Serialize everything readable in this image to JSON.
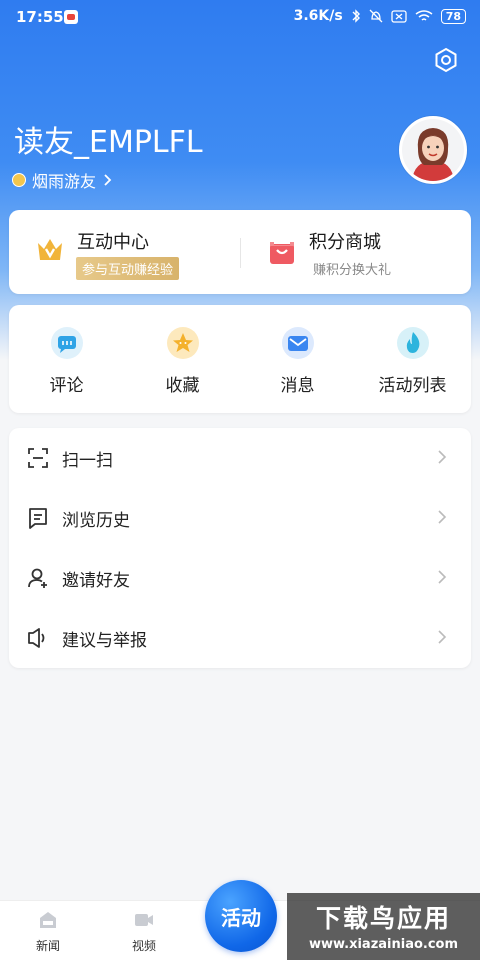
{
  "status_bar": {
    "time": "17:55",
    "network_speed": "3.6K/s",
    "battery": "78"
  },
  "profile": {
    "username": "读友_EMPLFL",
    "level": "烟雨游友"
  },
  "top_cards": [
    {
      "title": "互动中心",
      "subtitle": "参与互动赚经验",
      "accent": "#d9a43a"
    },
    {
      "title": "积分商城",
      "subtitle": "赚积分换大礼",
      "accent": "#e8505b"
    }
  ],
  "quick_actions": [
    {
      "label": "评论",
      "icon": "comment-icon"
    },
    {
      "label": "收藏",
      "icon": "star-icon"
    },
    {
      "label": "消息",
      "icon": "mail-icon"
    },
    {
      "label": "活动列表",
      "icon": "flame-icon"
    }
  ],
  "menu": [
    {
      "label": "扫一扫",
      "icon": "scan-icon"
    },
    {
      "label": "浏览历史",
      "icon": "history-icon"
    },
    {
      "label": "邀请好友",
      "icon": "invite-user-icon"
    },
    {
      "label": "建议与举报",
      "icon": "feedback-icon"
    }
  ],
  "bottom_nav": {
    "tabs": [
      {
        "label": "新闻"
      },
      {
        "label": "视频"
      }
    ],
    "center_label": "活动"
  },
  "watermark": {
    "title": "下载鸟应用",
    "url": "www.xiazainiao.com"
  },
  "colors": {
    "primary": "#2f7cf0",
    "text": "#222222"
  }
}
